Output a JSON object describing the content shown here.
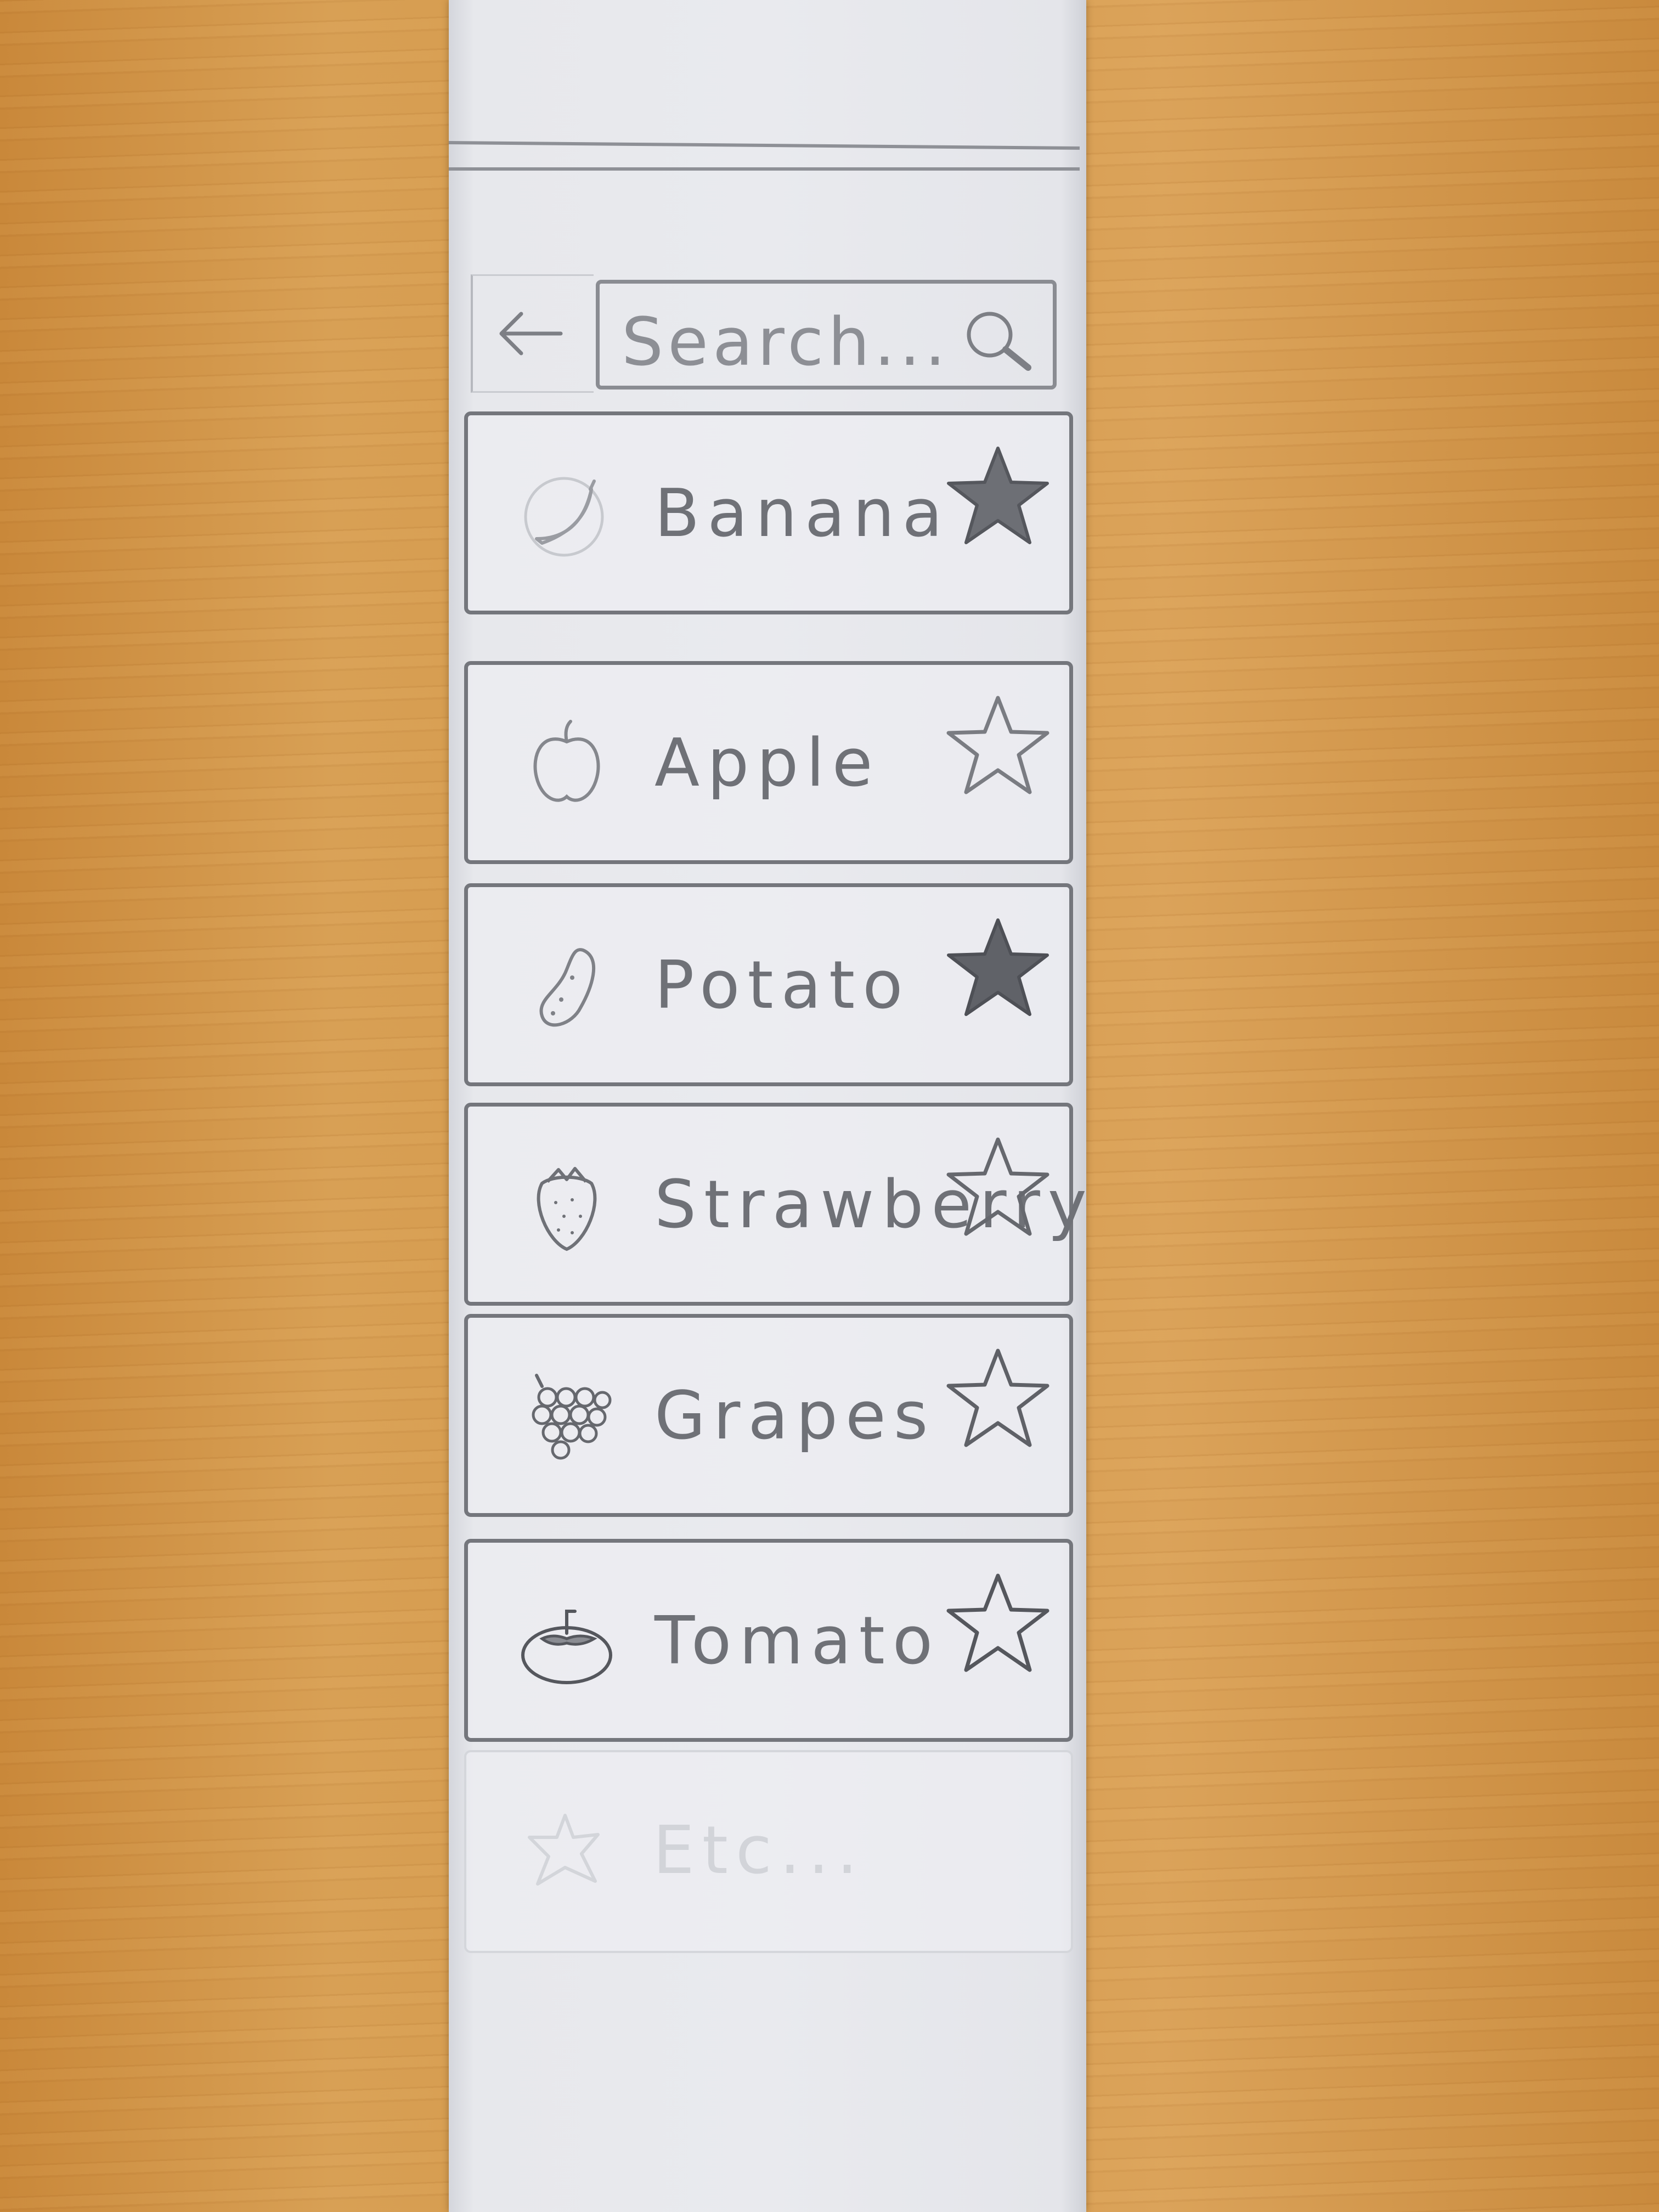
{
  "search": {
    "placeholder": "Search..."
  },
  "items": [
    {
      "label": "Banana",
      "icon": "banana-icon",
      "favorite": true
    },
    {
      "label": "Apple",
      "icon": "apple-icon",
      "favorite": false
    },
    {
      "label": "Potato",
      "icon": "potato-icon",
      "favorite": true
    },
    {
      "label": "Strawberry",
      "icon": "strawberry-icon",
      "favorite": false
    },
    {
      "label": "Grapes",
      "icon": "grapes-icon",
      "favorite": false
    },
    {
      "label": "Tomato",
      "icon": "tomato-icon",
      "favorite": false
    },
    {
      "label": "Etc...",
      "icon": "generic-fruit-icon",
      "favorite": false
    }
  ],
  "colors": {
    "pencil": "#74767c",
    "paper": "#e9eaee",
    "star_filled": "#5e6066"
  }
}
